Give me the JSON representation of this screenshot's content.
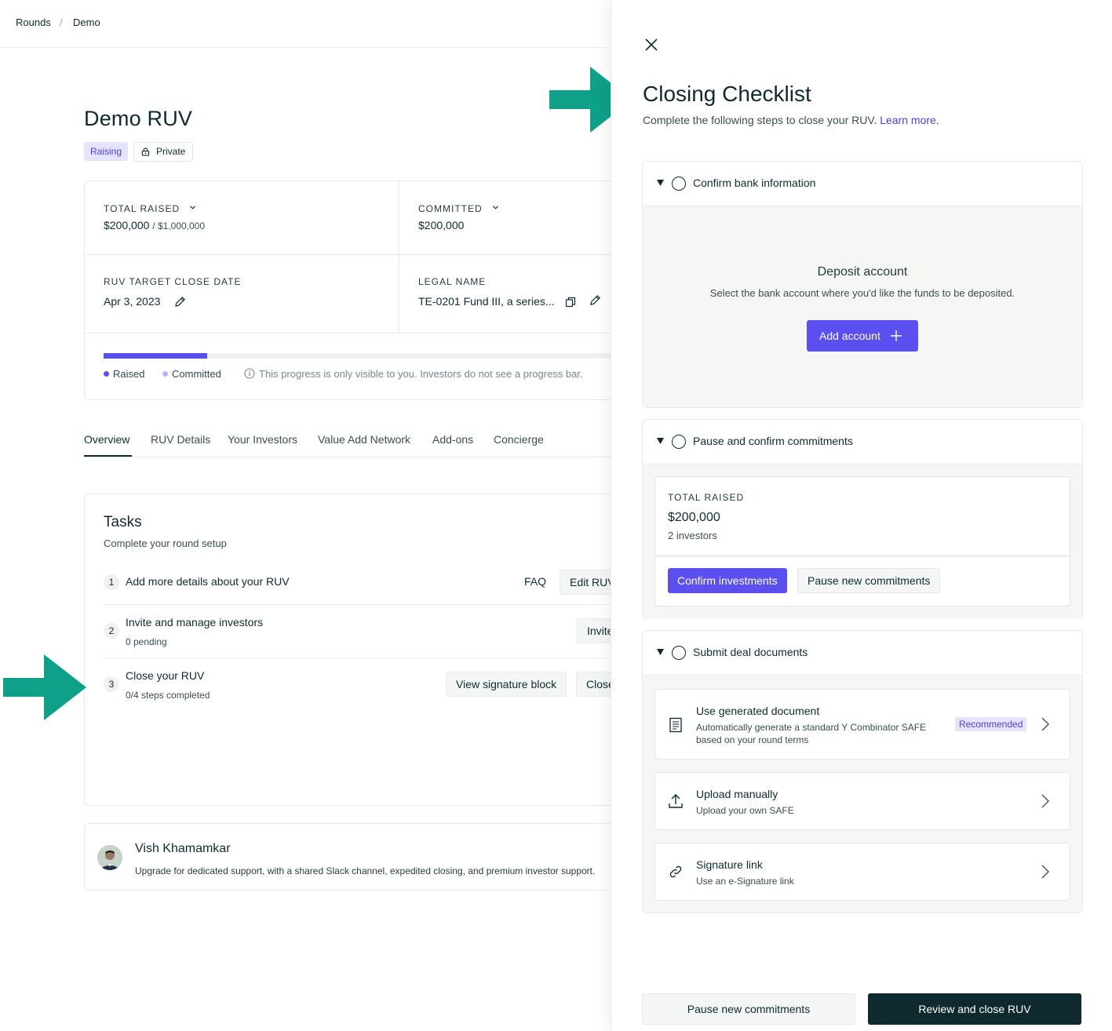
{
  "breadcrumb": {
    "items": [
      "Rounds",
      "Demo"
    ],
    "separator": "/"
  },
  "page": {
    "title": "Demo RUV",
    "status_badge": "Raising",
    "visibility_badge": "Private"
  },
  "stats": {
    "total_raised": {
      "label": "TOTAL RAISED",
      "value": "$200,000",
      "goal": "/ $1,000,000"
    },
    "committed": {
      "label": "COMMITTED",
      "value": "$200,000"
    },
    "target_close": {
      "label": "RUV TARGET CLOSE DATE",
      "value": "Apr 3, 2023"
    },
    "legal_name": {
      "label": "LEGAL NAME",
      "value": "TE-0201 Fund III, a series..."
    },
    "progress_fraction": 0.2,
    "legend_raised": "Raised",
    "legend_committed": "Committed",
    "progress_note": "This progress is only visible to you. Investors do not see a progress bar."
  },
  "tabs": [
    "Overview",
    "RUV Details",
    "Your Investors",
    "Value Add Network",
    "Add-ons",
    "Concierge"
  ],
  "tasks": {
    "title": "Tasks",
    "subtitle": "Complete your round setup",
    "items": [
      {
        "num": "1",
        "title": "Add more details about your RUV",
        "sub": "",
        "link": "FAQ",
        "button": "Edit RUV"
      },
      {
        "num": "2",
        "title": "Invite and manage investors",
        "sub": "0 pending",
        "button": "Invite"
      },
      {
        "num": "3",
        "title": "Close your RUV",
        "sub": "0/4 steps completed",
        "button_secondary": "View signature block",
        "button": "Close"
      }
    ]
  },
  "support": {
    "name": "Vish Khamamkar",
    "text": "Upgrade for dedicated support, with a shared Slack channel, expedited closing, and premium investor support."
  },
  "drawer": {
    "title": "Closing Checklist",
    "subtitle": "Complete the following steps to close your RUV.",
    "learn_more": "Learn more",
    "sections": {
      "bank": {
        "title": "Confirm bank information",
        "deposit_title": "Deposit account",
        "deposit_sub": "Select the bank account where you'd like the funds to be deposited.",
        "add_account": "Add account"
      },
      "commitments": {
        "title": "Pause and confirm commitments",
        "total_label": "TOTAL RAISED",
        "total_value": "$200,000",
        "investors": "2 investors",
        "confirm_button": "Confirm investments",
        "pause_button": "Pause new commitments"
      },
      "documents": {
        "title": "Submit deal documents",
        "options": [
          {
            "title": "Use generated document",
            "sub": "Automatically generate a standard Y Combinator SAFE based on your round terms",
            "badge": "Recommended"
          },
          {
            "title": "Upload manually",
            "sub": "Upload your own SAFE"
          },
          {
            "title": "Signature link",
            "sub": "Use an e-Signature link"
          }
        ]
      }
    },
    "footer": {
      "pause": "Pause new commitments",
      "review": "Review and close RUV"
    }
  },
  "colors": {
    "accent": "#5b4ff0",
    "dark": "#0f2a2e",
    "arrow": "#0fa08a",
    "badge_bg": "#e5e3ff"
  }
}
